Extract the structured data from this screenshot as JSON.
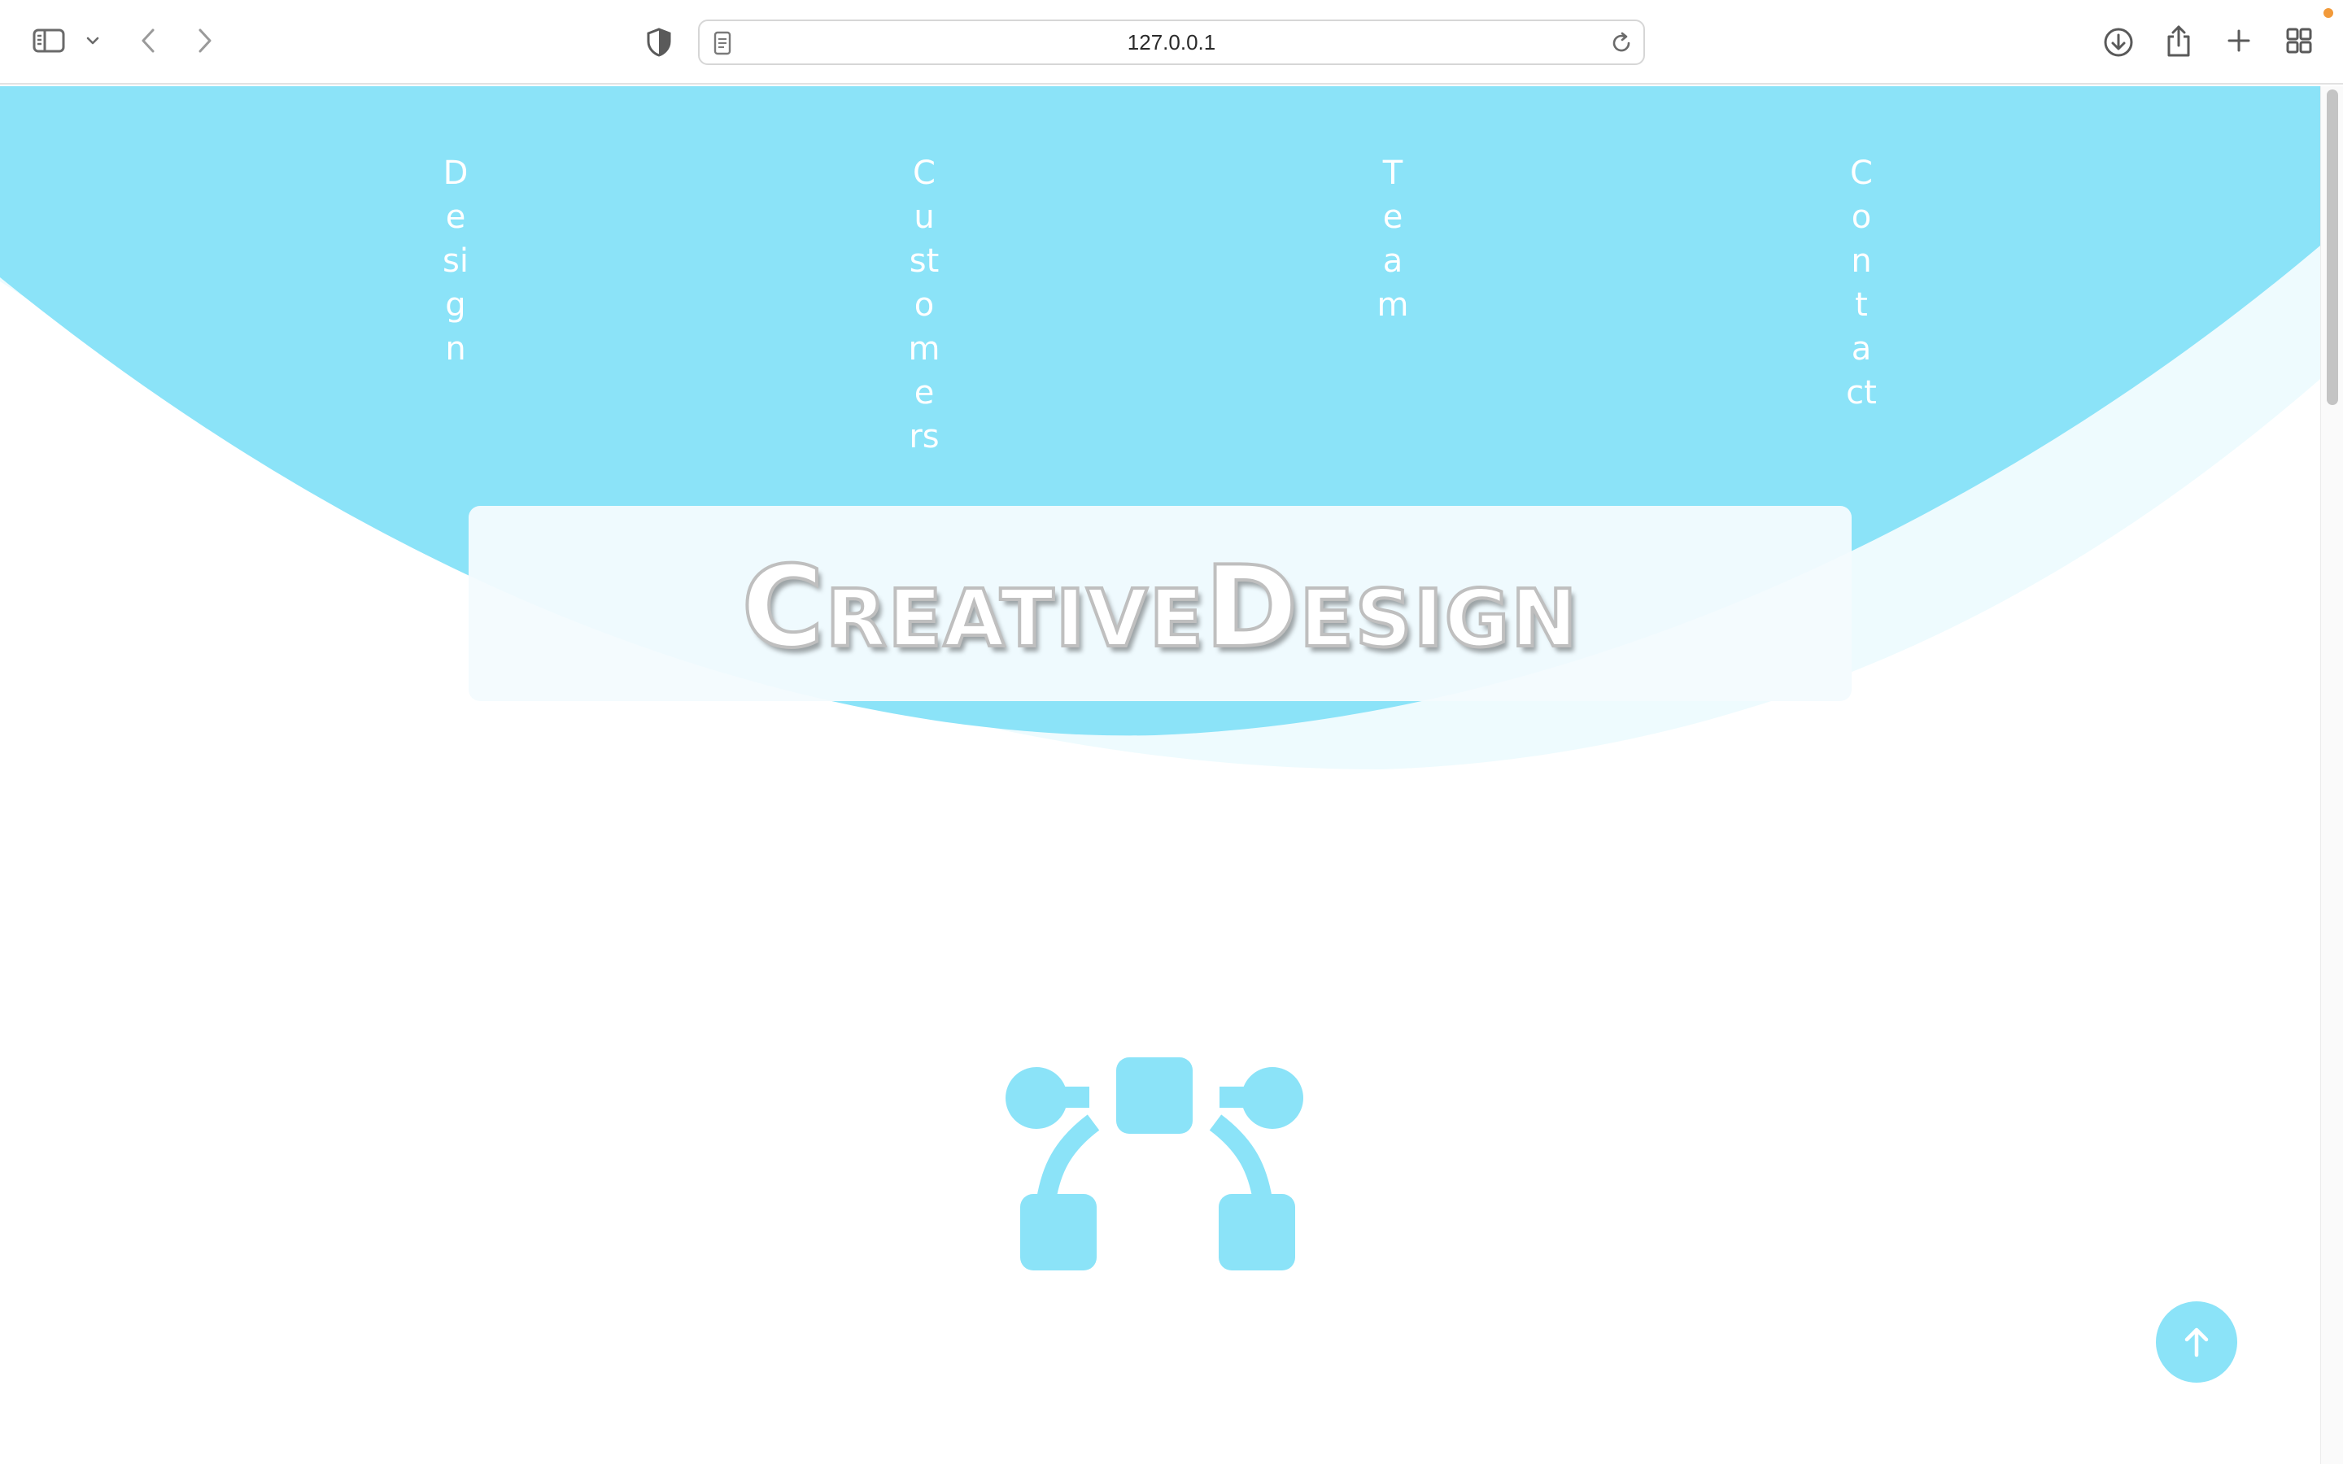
{
  "browser": {
    "url": "127.0.0.1",
    "icons": {
      "sidebar": "sidebar-icon",
      "sidebar_menu": "chevron-down-icon",
      "back": "chevron-left-icon",
      "forward": "chevron-right-icon",
      "privacy": "shield-icon",
      "page": "page-icon",
      "reload": "reload-icon",
      "downloads": "download-icon",
      "share": "share-icon",
      "new_tab": "plus-icon",
      "tab_overview": "grid-icon"
    }
  },
  "nav": {
    "items": [
      {
        "label": "Design"
      },
      {
        "label": "Customers"
      },
      {
        "label": "Team"
      },
      {
        "label": "Contact"
      }
    ]
  },
  "hero": {
    "title": "CreativeDesign"
  },
  "logo": {
    "icon": "vector-bezier-icon"
  },
  "scroll_top": {
    "icon": "arrow-up-icon"
  },
  "colors": {
    "accent": "#8be3f8",
    "accent_light": "#eefbfe",
    "title_stroke": "#bfbfbf",
    "notification": "#f29a3a"
  }
}
